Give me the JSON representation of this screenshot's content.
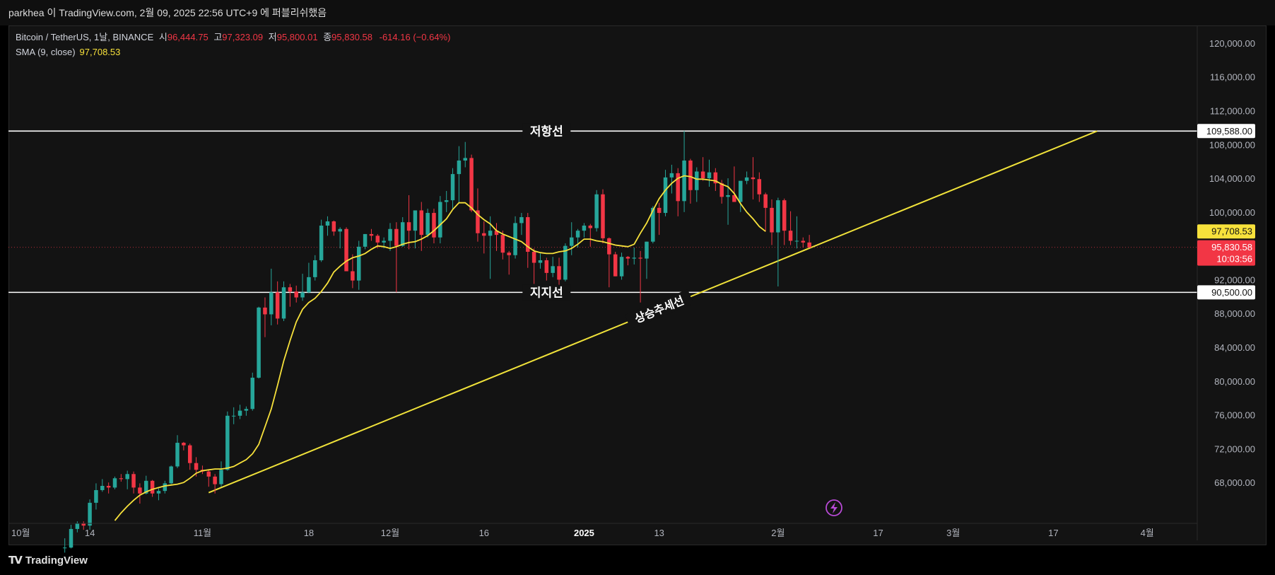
{
  "header": {
    "text": "parkhea 이 TradingView.com, 2월 09, 2025 22:56 UTC+9 에 퍼블리쉬했음"
  },
  "legend": {
    "symbol": "Bitcoin / TetherUS, 1날, BINANCE",
    "open_label": "시",
    "open": "96,444.75",
    "high_label": "고",
    "high": "97,323.09",
    "low_label": "저",
    "low": "95,800.01",
    "close_label": "종",
    "close": "95,830.58",
    "change": "-614.16 (−0.64%)",
    "sma_label": "SMA (9, close)",
    "sma_value": "97,708.53"
  },
  "footer": {
    "brand": "TradingView",
    "logo_icon": "tradingview-logo-icon"
  },
  "colors": {
    "up": "#26a69a",
    "down": "#f23645",
    "sma": "#f7e13b",
    "trend": "#f0e23a",
    "level": "#ffffff",
    "background": "#131313"
  },
  "chart_data": {
    "type": "candlestick",
    "symbol": "Bitcoin / TetherUS",
    "interval": "1날",
    "exchange": "BINANCE",
    "ylim": [
      64000,
      122000
    ],
    "y_ticks": [
      68000,
      72000,
      76000,
      80000,
      84000,
      88000,
      92000,
      100000,
      104000,
      108000,
      112000,
      116000,
      120000
    ],
    "y_tick_labels": [
      "68,000.00",
      "72,000.00",
      "76,000.00",
      "80,000.00",
      "84,000.00",
      "88,000.00",
      "92,000.00",
      "100,000.00",
      "104,000.00",
      "108,000.00",
      "112,000.00",
      "116,000.00",
      "120,000.00"
    ],
    "xlim": [
      "2024-10-01",
      "2025-04-09"
    ],
    "x_ticks": [
      {
        "date": "2024-10-01",
        "label": "10월",
        "bold": false
      },
      {
        "date": "2024-10-14",
        "label": "14",
        "bold": false
      },
      {
        "date": "2024-11-01",
        "label": "11월",
        "bold": false
      },
      {
        "date": "2024-11-18",
        "label": "18",
        "bold": false
      },
      {
        "date": "2024-12-01",
        "label": "12월",
        "bold": false
      },
      {
        "date": "2024-12-16",
        "label": "16",
        "bold": false
      },
      {
        "date": "2025-01-01",
        "label": "2025",
        "bold": true
      },
      {
        "date": "2025-01-13",
        "label": "13",
        "bold": false
      },
      {
        "date": "2025-02-01",
        "label": "2월",
        "bold": false
      },
      {
        "date": "2025-02-17",
        "label": "17",
        "bold": false
      },
      {
        "date": "2025-03-01",
        "label": "3월",
        "bold": false
      },
      {
        "date": "2025-03-17",
        "label": "17",
        "bold": false
      },
      {
        "date": "2025-04-01",
        "label": "4월",
        "bold": false
      }
    ],
    "candles_start": "2024-10-10",
    "candles_ohlc": [
      [
        60300,
        61400,
        59700,
        60300
      ],
      [
        60300,
        63000,
        60200,
        62500
      ],
      [
        62500,
        63400,
        62100,
        63200
      ],
      [
        63200,
        63400,
        62400,
        62900
      ],
      [
        62900,
        66000,
        62400,
        65600
      ],
      [
        65600,
        67900,
        64800,
        67100
      ],
      [
        67100,
        68400,
        66900,
        67600
      ],
      [
        67600,
        68000,
        66700,
        67400
      ],
      [
        67400,
        68700,
        67200,
        68500
      ],
      [
        68500,
        69000,
        68100,
        68400
      ],
      [
        68400,
        69400,
        67200,
        69000
      ],
      [
        69000,
        69300,
        66700,
        67400
      ],
      [
        67400,
        67900,
        65500,
        66700
      ],
      [
        66700,
        68800,
        66600,
        68200
      ],
      [
        68200,
        68300,
        66300,
        66700
      ],
      [
        66700,
        67300,
        65900,
        67000
      ],
      [
        67000,
        68200,
        66700,
        67900
      ],
      [
        67900,
        70000,
        67800,
        69900
      ],
      [
        69900,
        73600,
        69700,
        72700
      ],
      [
        72700,
        72800,
        71800,
        72400
      ],
      [
        72400,
        72600,
        69500,
        70300
      ],
      [
        70300,
        71000,
        68700,
        69500
      ],
      [
        69500,
        70000,
        69000,
        69300
      ],
      [
        69300,
        69500,
        67500,
        68700
      ],
      [
        68700,
        69000,
        66700,
        67800
      ],
      [
        67800,
        70500,
        67500,
        69500
      ],
      [
        69500,
        76400,
        69400,
        75900
      ],
      [
        75900,
        76900,
        74900,
        75900
      ],
      [
        75900,
        77200,
        75500,
        76500
      ],
      [
        76500,
        77000,
        75900,
        76700
      ],
      [
        76700,
        81000,
        76500,
        80400
      ],
      [
        80400,
        88800,
        80300,
        88700
      ],
      [
        88700,
        89900,
        85200,
        87900
      ],
      [
        87900,
        93300,
        86600,
        90500
      ],
      [
        90500,
        91800,
        86700,
        87400
      ],
      [
        87400,
        91800,
        87100,
        91100
      ],
      [
        91100,
        91500,
        88800,
        90600
      ],
      [
        90600,
        91300,
        89300,
        89900
      ],
      [
        89900,
        92700,
        89500,
        90500
      ],
      [
        90500,
        94000,
        90400,
        92300
      ],
      [
        92300,
        94900,
        91900,
        94300
      ],
      [
        94300,
        99100,
        94100,
        98400
      ],
      [
        98400,
        99500,
        97200,
        98900
      ],
      [
        98900,
        99000,
        97200,
        97700
      ],
      [
        97700,
        98200,
        95700,
        98000
      ],
      [
        98000,
        98200,
        93200,
        93000
      ],
      [
        93000,
        95000,
        91000,
        91900
      ],
      [
        91900,
        96600,
        90800,
        95900
      ],
      [
        95900,
        97400,
        95600,
        97400
      ],
      [
        97400,
        98000,
        96600,
        97200
      ],
      [
        97200,
        97400,
        95700,
        96400
      ],
      [
        96400,
        97000,
        95700,
        96600
      ],
      [
        96600,
        98700,
        95400,
        98000
      ],
      [
        98000,
        98800,
        90500,
        96000
      ],
      [
        96000,
        99400,
        95900,
        98800
      ],
      [
        98800,
        102000,
        95600,
        97800
      ],
      [
        97800,
        99500,
        95700,
        100200
      ],
      [
        100200,
        101200,
        95400,
        97300
      ],
      [
        97300,
        100400,
        97000,
        99900
      ],
      [
        99900,
        100400,
        96300,
        97000
      ],
      [
        97000,
        101900,
        96300,
        101200
      ],
      [
        101200,
        102500,
        100000,
        101400
      ],
      [
        101400,
        105200,
        100300,
        104500
      ],
      [
        104500,
        107800,
        101100,
        106100
      ],
      [
        106100,
        108300,
        105300,
        106400
      ],
      [
        106400,
        106800,
        100000,
        100200
      ],
      [
        100200,
        102800,
        96500,
        97500
      ],
      [
        97500,
        98900,
        95100,
        97200
      ],
      [
        97200,
        99500,
        92100,
        97800
      ],
      [
        97800,
        98700,
        95400,
        97300
      ],
      [
        97300,
        97800,
        94400,
        95200
      ],
      [
        95200,
        95400,
        92600,
        94900
      ],
      [
        94900,
        99500,
        94500,
        98700
      ],
      [
        98700,
        99900,
        97300,
        99400
      ],
      [
        99400,
        99900,
        93400,
        95300
      ],
      [
        95300,
        95700,
        91500,
        94000
      ],
      [
        94000,
        95100,
        93300,
        94300
      ],
      [
        94300,
        94600,
        91900,
        92800
      ],
      [
        92800,
        94700,
        92300,
        93600
      ],
      [
        93600,
        94600,
        91400,
        92000
      ],
      [
        92000,
        96300,
        91800,
        96000
      ],
      [
        96000,
        98800,
        94900,
        97000
      ],
      [
        97000,
        98000,
        95800,
        97800
      ],
      [
        97800,
        98700,
        97000,
        98400
      ],
      [
        98400,
        98600,
        95900,
        98100
      ],
      [
        98100,
        102600,
        97700,
        102100
      ],
      [
        102100,
        102700,
        96300,
        96900
      ],
      [
        96900,
        97000,
        91100,
        95000
      ],
      [
        95000,
        95300,
        92400,
        92400
      ],
      [
        92400,
        95200,
        92000,
        94700
      ],
      [
        94700,
        94800,
        93700,
        94500
      ],
      [
        94500,
        95800,
        93800,
        94600
      ],
      [
        94600,
        95400,
        89300,
        94500
      ],
      [
        94500,
        96500,
        92100,
        96500
      ],
      [
        96500,
        100700,
        96300,
        100500
      ],
      [
        100500,
        101100,
        97300,
        99900
      ],
      [
        99900,
        105000,
        99500,
        104100
      ],
      [
        104100,
        105600,
        102200,
        104600
      ],
      [
        104600,
        105200,
        99500,
        101300
      ],
      [
        101300,
        109600,
        100000,
        106100
      ],
      [
        106100,
        106300,
        101000,
        102600
      ],
      [
        102600,
        105300,
        101200,
        104800
      ],
      [
        104800,
        106500,
        103700,
        104000
      ],
      [
        104000,
        106200,
        103000,
        104700
      ],
      [
        104700,
        105200,
        102500,
        103400
      ],
      [
        103400,
        103800,
        101000,
        101800
      ],
      [
        101800,
        104000,
        98500,
        102000
      ],
      [
        102000,
        105400,
        101400,
        101200
      ],
      [
        101200,
        103200,
        100000,
        103700
      ],
      [
        103700,
        104800,
        103300,
        104100
      ],
      [
        104100,
        106500,
        101500,
        103900
      ],
      [
        103900,
        104700,
        101200,
        102100
      ],
      [
        102100,
        102300,
        97700,
        100500
      ],
      [
        100500,
        101500,
        96100,
        97600
      ],
      [
        97600,
        101700,
        91200,
        101400
      ],
      [
        101400,
        101600,
        96100,
        97800
      ],
      [
        97800,
        100100,
        96100,
        96600
      ],
      [
        96600,
        99500,
        95700,
        96600
      ],
      [
        96600,
        97000,
        95800,
        96400
      ],
      [
        96400,
        97300,
        95800,
        95800
      ]
    ],
    "sma": {
      "name": "SMA (9, close)",
      "last": 97708.53,
      "start": "2024-10-18",
      "values": [
        63500,
        64400,
        65200,
        65900,
        66500,
        66900,
        67200,
        67400,
        67600,
        67700,
        67800,
        68000,
        68500,
        69100,
        69400,
        69500,
        69600,
        69600,
        69700,
        69900,
        70300,
        70700,
        71400,
        72500,
        74600,
        76700,
        79500,
        82400,
        84800,
        87000,
        88500,
        89300,
        89800,
        90600,
        91600,
        92900,
        93600,
        94200,
        94600,
        94800,
        95100,
        95600,
        96000,
        95900,
        95700,
        95900,
        96200,
        96400,
        96500,
        96800,
        97200,
        97800,
        98500,
        99200,
        100300,
        101100,
        101100,
        100500,
        99700,
        99100,
        98600,
        97800,
        97400,
        97100,
        96800,
        96500,
        95900,
        95400,
        95200,
        95100,
        95100,
        95300,
        95400,
        95700,
        96200,
        96800,
        96800,
        96600,
        96500,
        96300,
        96100,
        96000,
        95900,
        96200,
        97500,
        98700,
        100200,
        101600,
        102600,
        103400,
        104000,
        104300,
        104200,
        103900,
        103900,
        103800,
        103700,
        103300,
        103000,
        102200,
        101000,
        100000,
        99200,
        98300,
        97708.53
      ]
    },
    "last_price": 95830.58,
    "price_labels": [
      {
        "value": 109588.0,
        "text": "109,588.00",
        "style": "level"
      },
      {
        "value": 97708.53,
        "text": "97,708.53",
        "style": "sma"
      },
      {
        "value": 95830.58,
        "text": "95,830.58",
        "countdown": "10:03:56",
        "style": "last"
      },
      {
        "value": 90500.0,
        "text": "90,500.00",
        "style": "level"
      }
    ],
    "horizontal_lines": [
      {
        "value": 109588.0,
        "label": "저항선",
        "label_at": "2024-12-26"
      },
      {
        "value": 90500.0,
        "label": "지지선",
        "label_at": "2024-12-26"
      }
    ],
    "trend_line": {
      "from": {
        "date": "2024-11-02",
        "value": 66800
      },
      "to": {
        "date": "2025-03-24",
        "value": 109588
      },
      "label": "상승추세선",
      "label_at": "2025-01-13"
    },
    "grid": false,
    "legend_position": "top-left"
  }
}
